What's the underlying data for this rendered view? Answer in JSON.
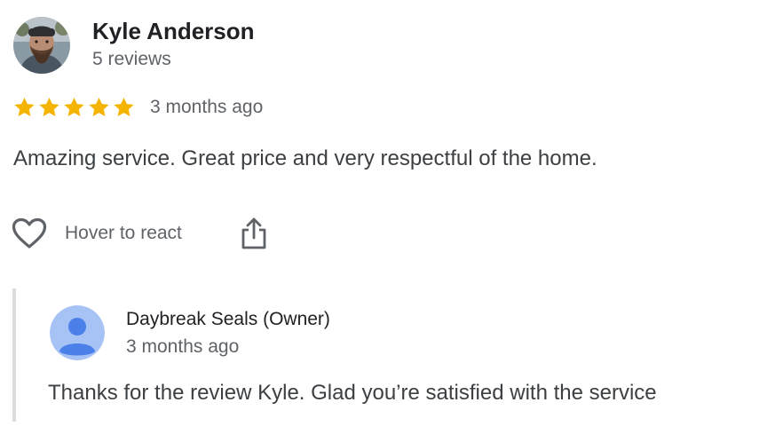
{
  "review": {
    "reviewer_name": "Kyle Anderson",
    "reviewer_reviews": "5 reviews",
    "rating": 5,
    "rating_max": 5,
    "time": "3 months ago",
    "text": "Amazing service. Great price and very respectful of the home."
  },
  "actions": {
    "react_label": "Hover to react",
    "heart_icon": "heart-outline-icon",
    "share_icon": "share-icon"
  },
  "owner_reply": {
    "name": "Daybreak Seals (Owner)",
    "time": "3 months ago",
    "text": "Thanks for the review Kyle. Glad you’re satisfied with the service"
  },
  "colors": {
    "star": "#f4b400",
    "owner_avatar_bg": "#a7c2f5",
    "owner_avatar_fg": "#4a80e8",
    "reply_border": "#dadce0"
  }
}
